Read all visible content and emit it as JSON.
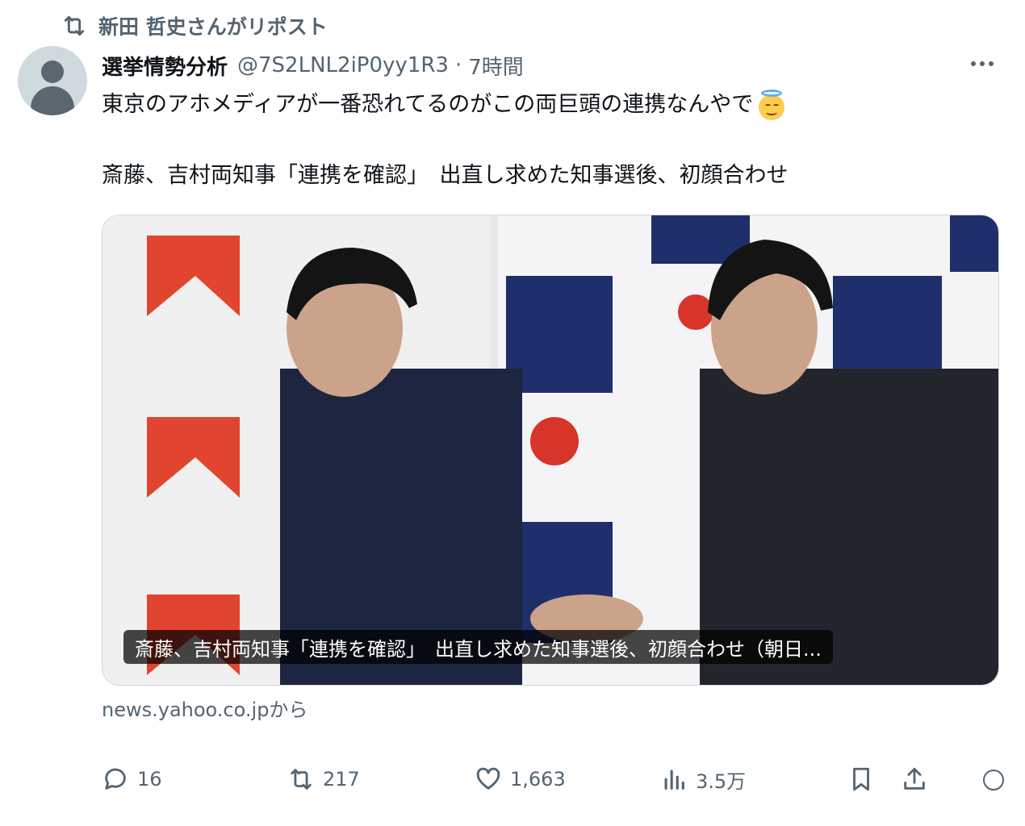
{
  "repost": {
    "text": "新田 哲史さんがリポスト"
  },
  "author": {
    "display_name": "選挙情勢分析",
    "handle": "@7S2LNL2iP0yy1R3",
    "separator": "·",
    "time": "7時間"
  },
  "tweet": {
    "line1": "東京のアホメディアが一番恐れてるのがこの両巨頭の連携なんやで",
    "emoji": "smiling-face-with-halo",
    "line2": "斎藤、吉村両知事「連携を確認」　出直し求めた知事選後、初顔合わせ"
  },
  "card": {
    "caption": "斎藤、吉村両知事「連携を確認」　出直し求めた知事選後、初顔合わせ（朝日...",
    "source": "news.yahoo.co.jpから"
  },
  "actions": {
    "replies": "16",
    "reposts": "217",
    "likes": "1,663",
    "views": "3.5万"
  },
  "colors": {
    "text": "#0f1419",
    "muted": "#536471",
    "border": "#cfd9de"
  },
  "icons": [
    "repost-icon",
    "more-icon",
    "reply-icon",
    "like-icon",
    "views-icon",
    "bookmark-icon",
    "share-icon"
  ]
}
